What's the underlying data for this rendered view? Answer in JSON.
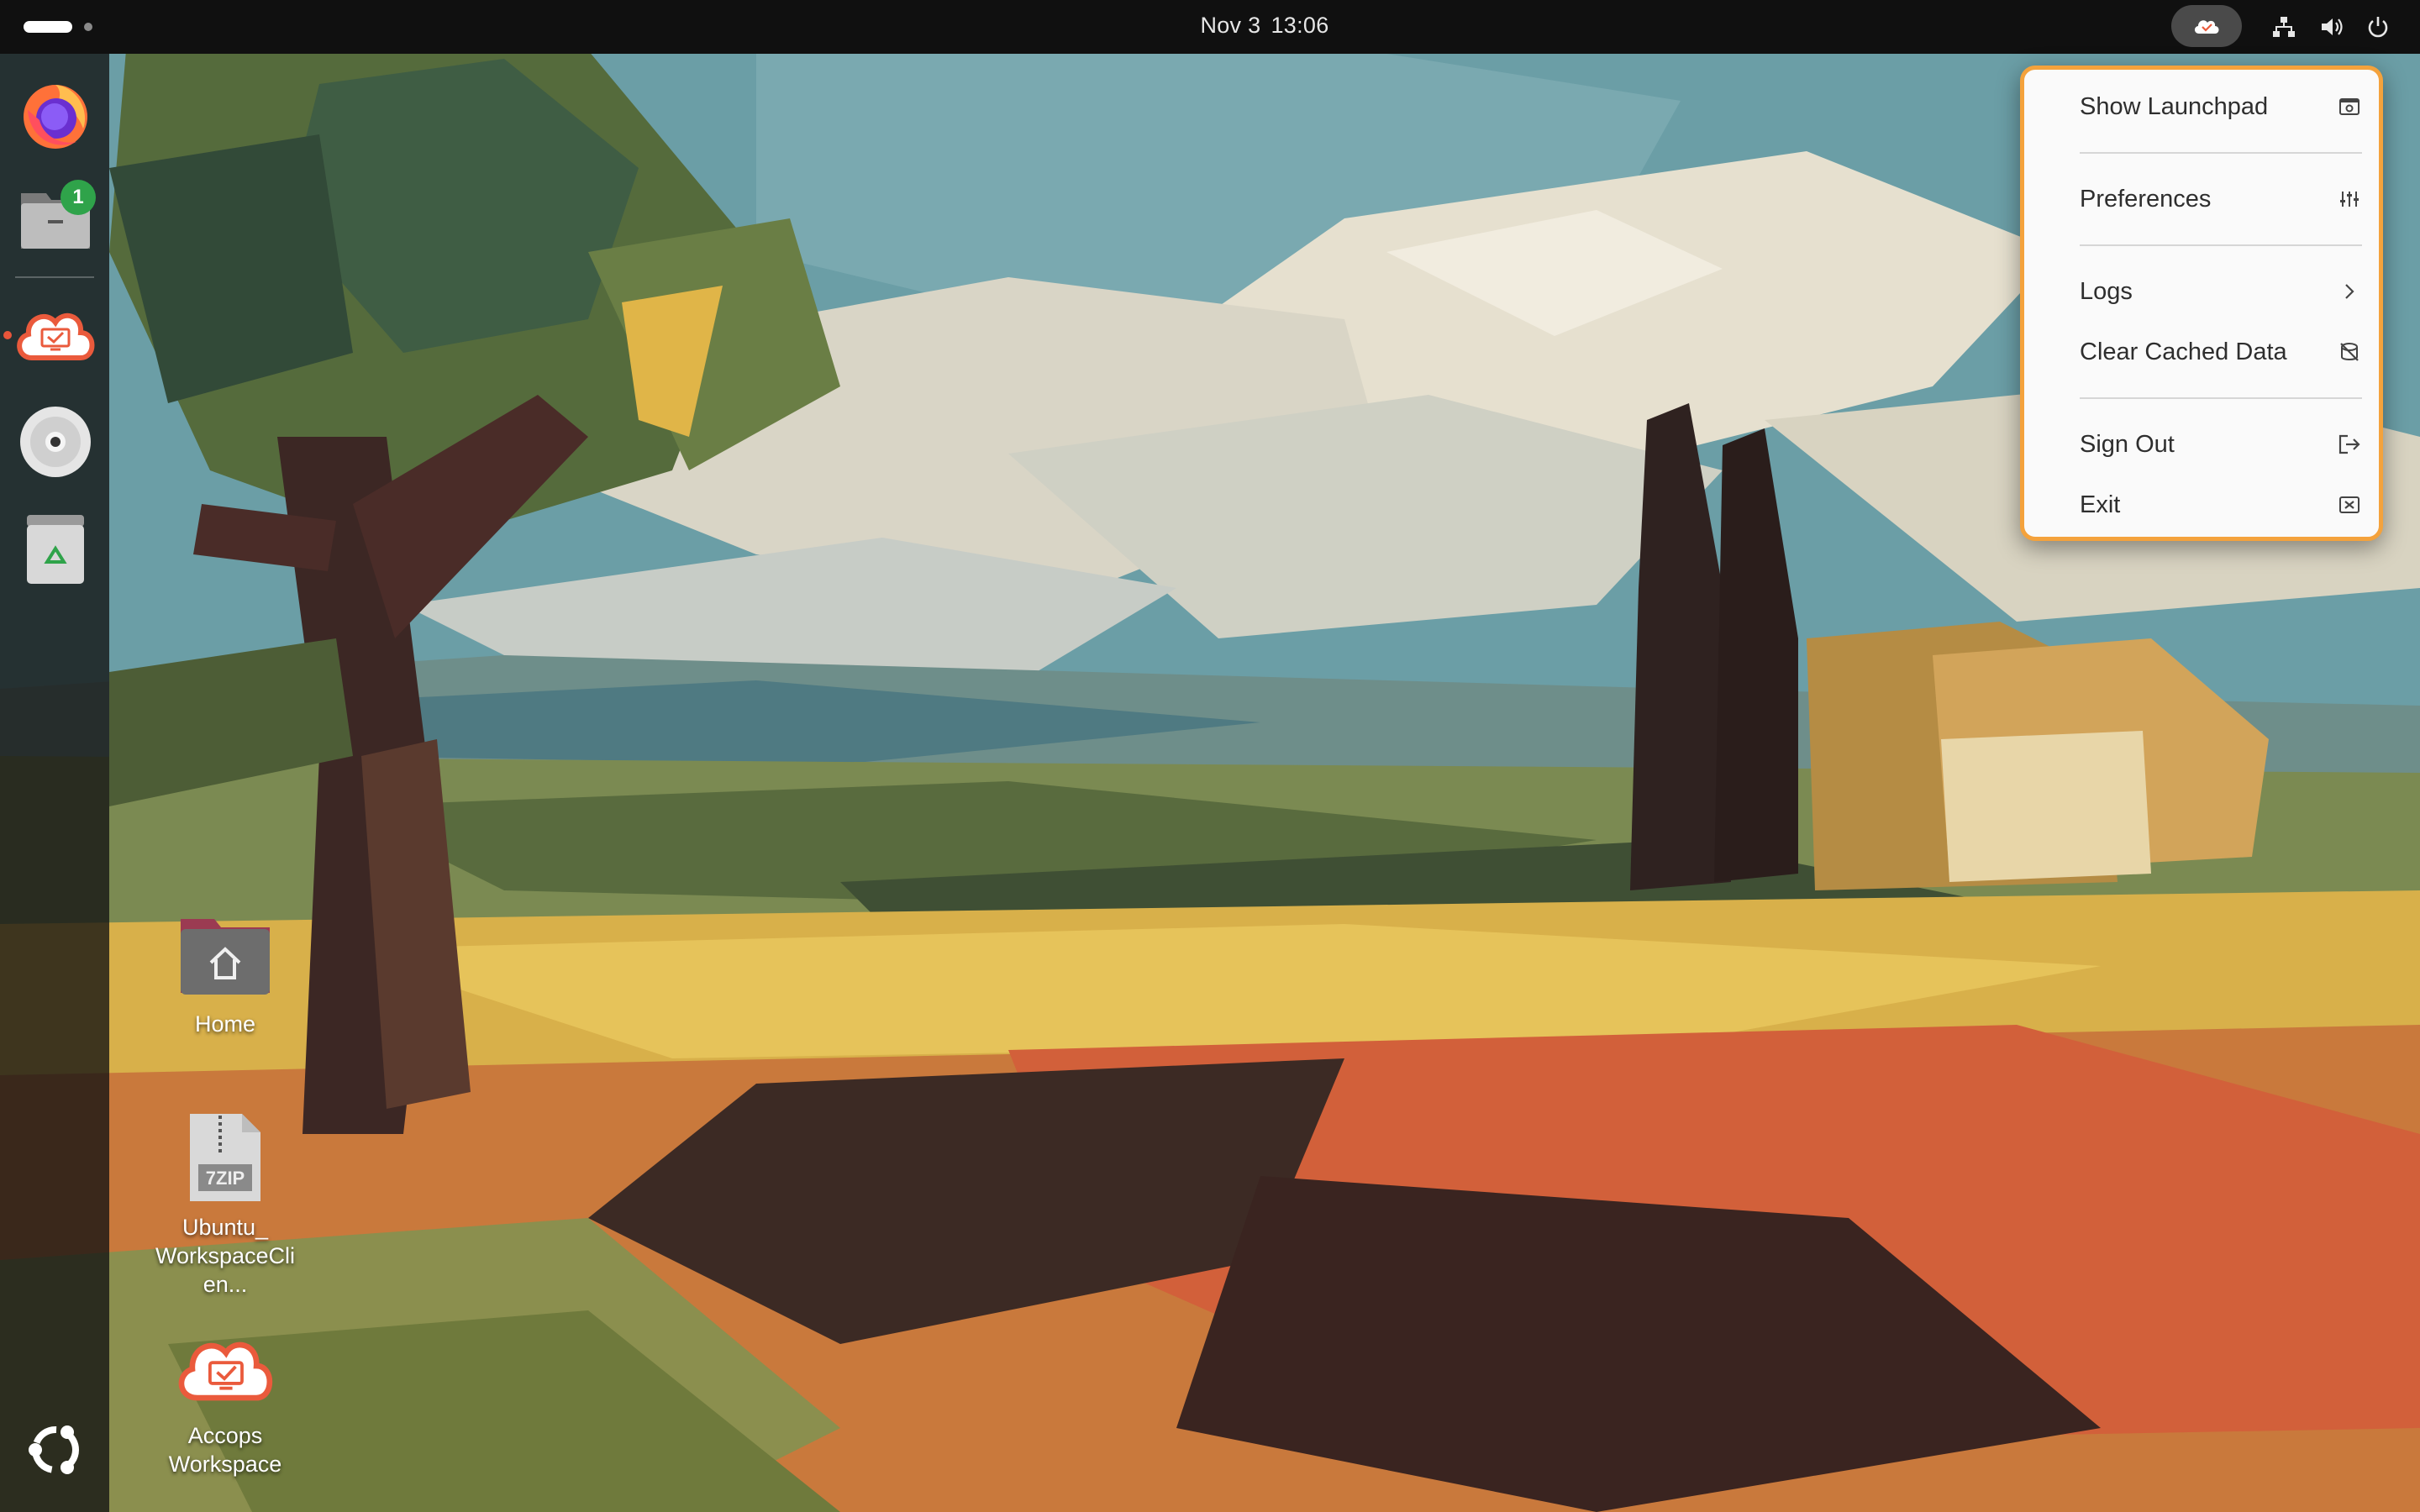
{
  "topbar": {
    "date": "Nov 3",
    "time": "13:06"
  },
  "dock": {
    "items": [
      {
        "name": "Firefox",
        "icon": "firefox-icon"
      },
      {
        "name": "Files",
        "icon": "files-folder-icon",
        "badge": "1"
      },
      {
        "name": "Accops Workspace",
        "icon": "accops-cloud-icon",
        "running": true
      },
      {
        "name": "Disc",
        "icon": "disc-icon"
      },
      {
        "name": "Trash",
        "icon": "trash-icon"
      }
    ],
    "apps_button_icon": "ubuntu-logo-icon"
  },
  "desktop": {
    "icons": [
      {
        "label": "Home",
        "icon": "home-folder-icon"
      },
      {
        "label": "Ubuntu_\nWorkspaceClien...",
        "icon": "7zip-archive-icon"
      },
      {
        "label": "Accops Workspace",
        "icon": "accops-cloud-icon"
      }
    ]
  },
  "menu": {
    "items": [
      {
        "label": "Show Launchpad",
        "icon": "launchpad-icon"
      },
      {
        "label": "Preferences",
        "icon": "sliders-icon"
      },
      {
        "label": "Logs",
        "icon": "chevron-right-icon"
      },
      {
        "label": "Clear Cached Data",
        "icon": "clear-data-icon"
      },
      {
        "label": "Sign Out",
        "icon": "sign-out-icon"
      },
      {
        "label": "Exit",
        "icon": "exit-icon"
      }
    ]
  },
  "colors": {
    "menu_border": "#f4a23c",
    "badge": "#2fa34a",
    "accops_brand": "#ea5a3c"
  }
}
